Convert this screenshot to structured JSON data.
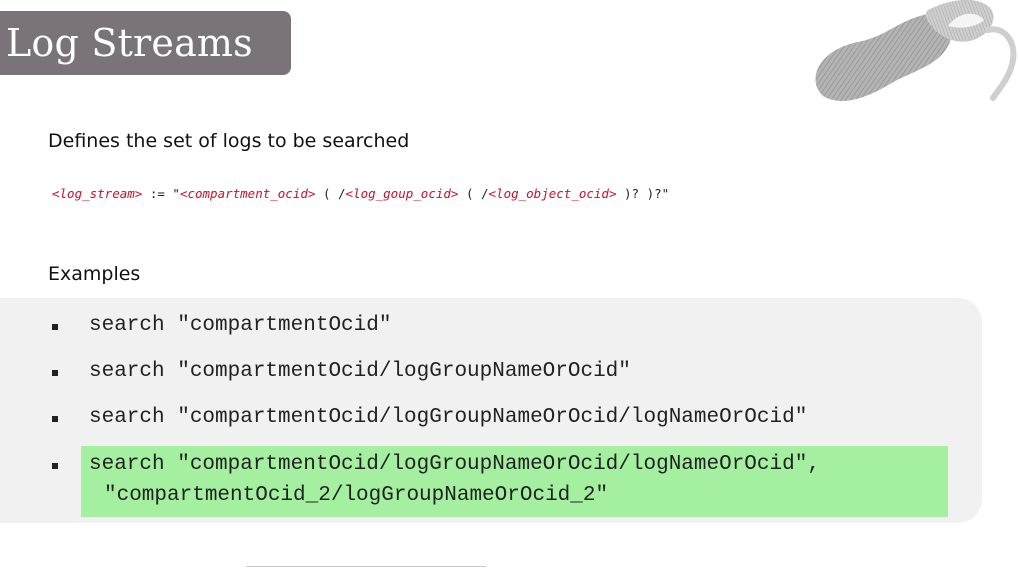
{
  "slide": {
    "title": "Log Streams",
    "heading": "Defines the set of logs to be searched",
    "syntax": {
      "t1": "<log_stream>",
      "t2": " := \"",
      "t3": "<compartment_ocid>",
      "t4": " ( /",
      "t5": "<log_goup_ocid>",
      "t6": " ( /",
      "t7": "<log_object_ocid>",
      "t8": " )? )?\""
    },
    "examples_label": "Examples",
    "examples": [
      "search \"compartmentOcid\"",
      "search \"compartmentOcid/logGroupNameOrOcid\"",
      "search \"compartmentOcid/logGroupNameOrOcid/logNameOrOcid\"",
      "search \"compartmentOcid/logGroupNameOrOcid/logNameOrOcid\",",
      "\"compartmentOcid_2/logGroupNameOrOcid_2\""
    ]
  },
  "colors": {
    "title_bg": "#7a7379",
    "syntax_token": "#c8102e",
    "highlight": "#a4f0a0",
    "panel_bg": "#f2f1f2"
  }
}
